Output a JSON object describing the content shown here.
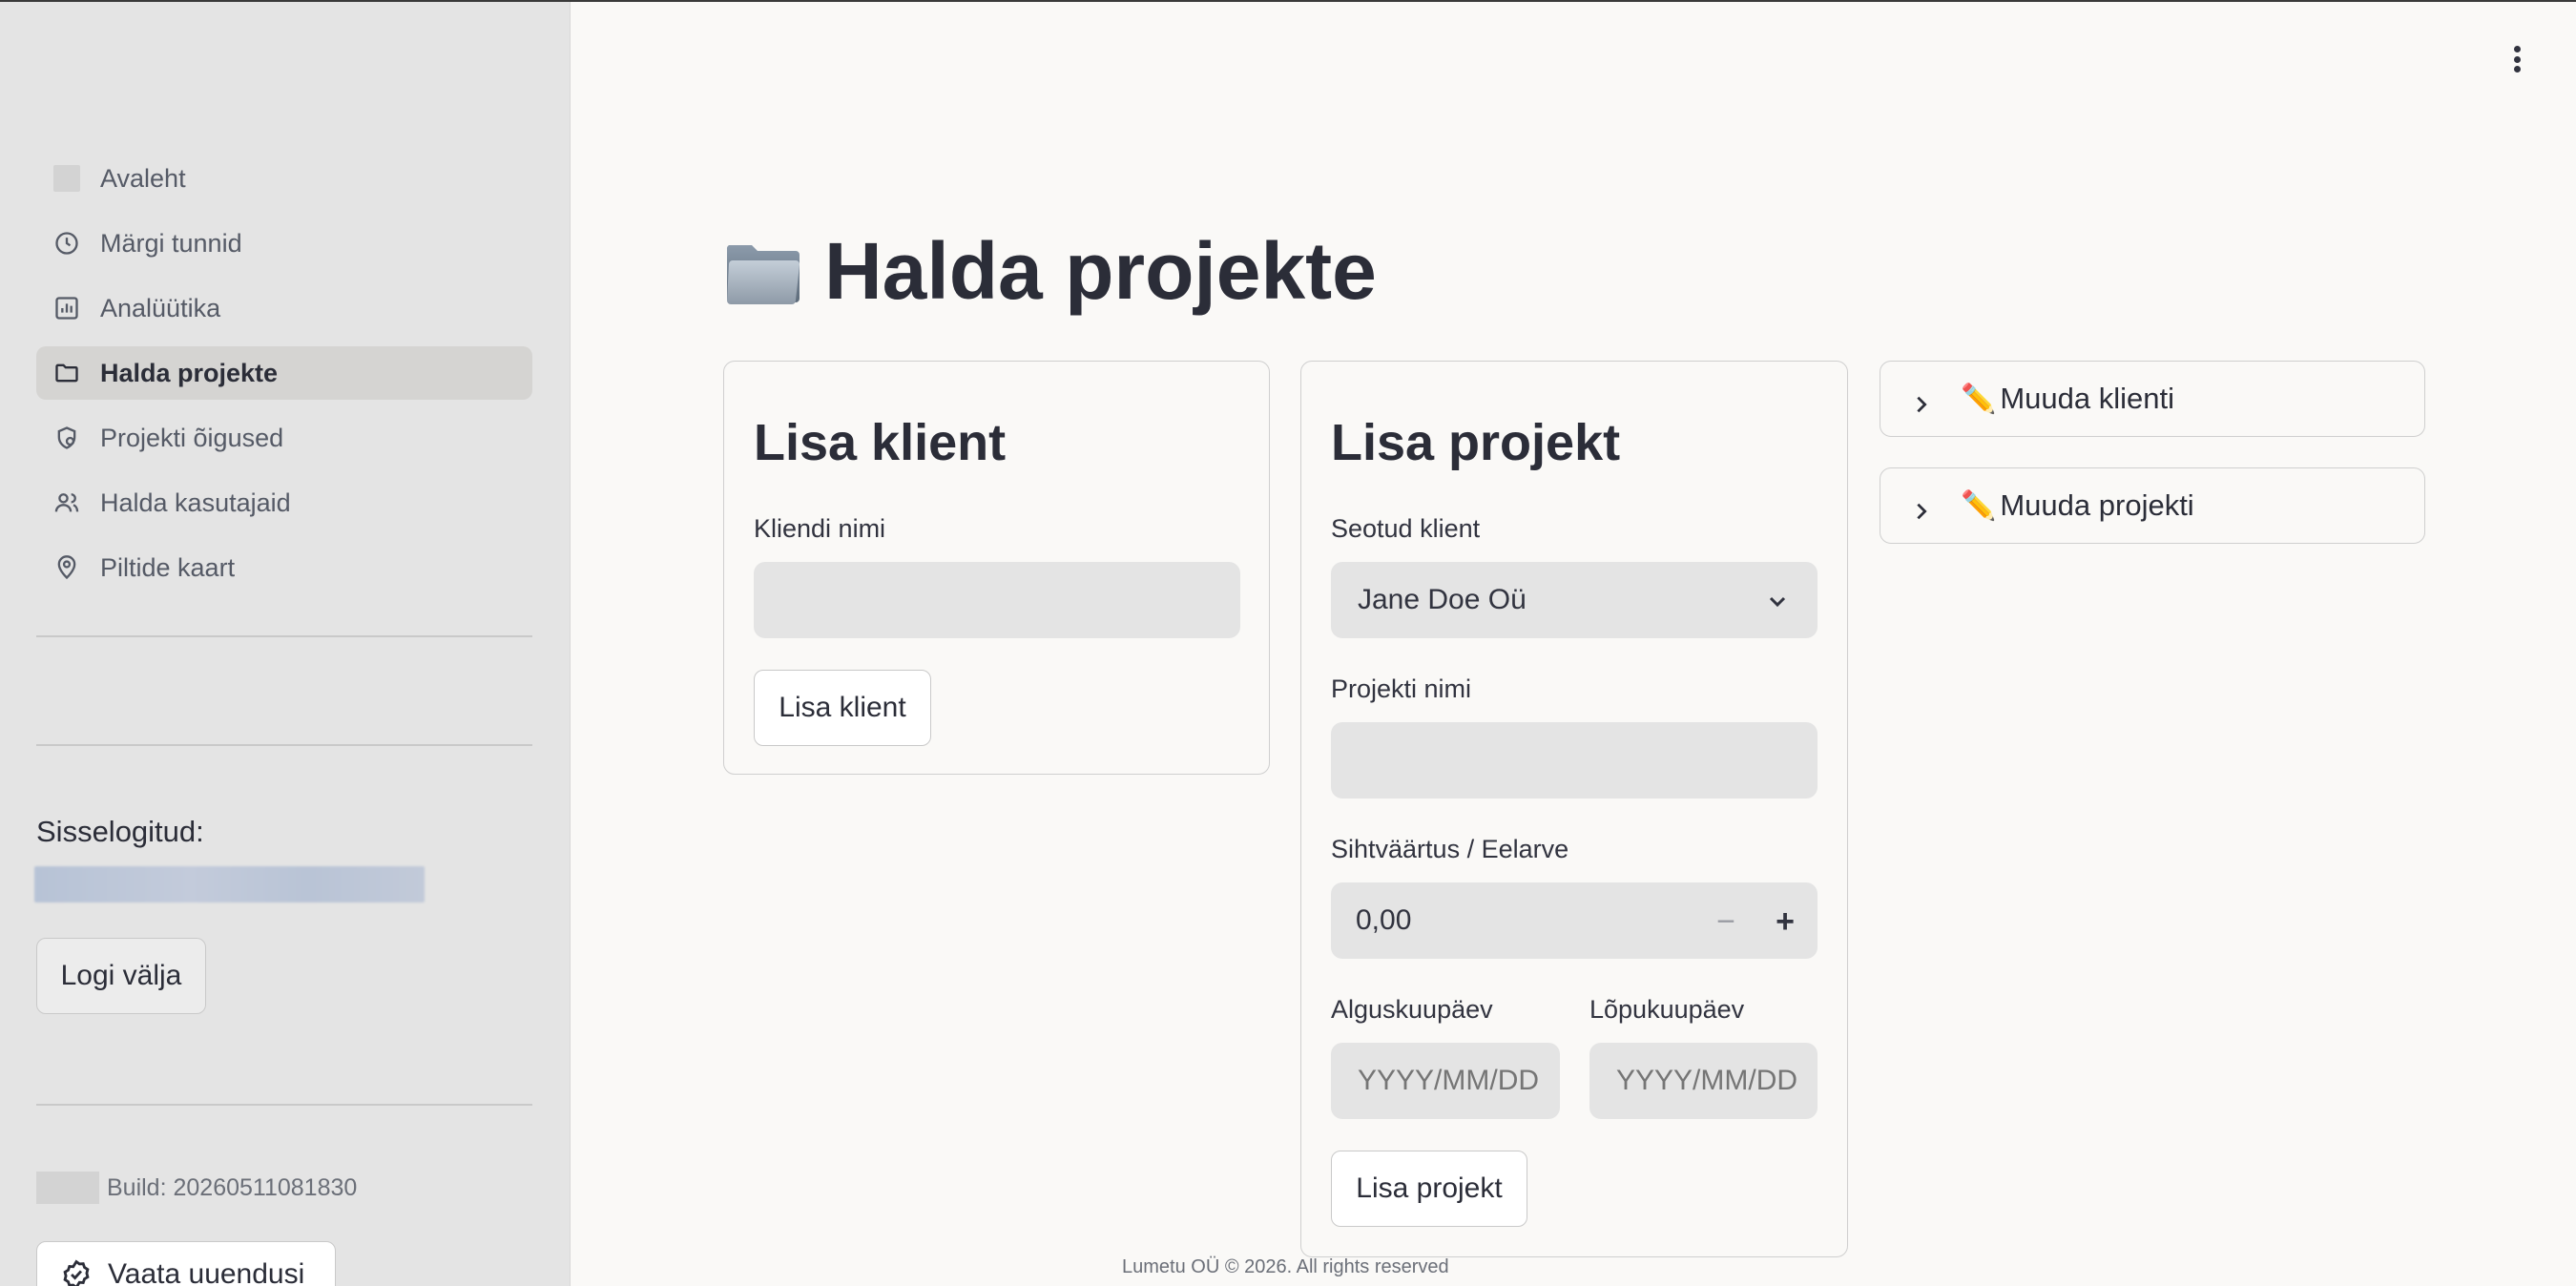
{
  "sidebar": {
    "items": [
      {
        "label": "Avaleht",
        "icon": "image-placeholder-icon"
      },
      {
        "label": "Märgi tunnid",
        "icon": "clock-icon"
      },
      {
        "label": "Analüütika",
        "icon": "bar-chart-icon"
      },
      {
        "label": "Halda projekte",
        "icon": "folder-icon",
        "active": true
      },
      {
        "label": "Projekti õigused",
        "icon": "shield-lock-icon"
      },
      {
        "label": "Halda kasutajaid",
        "icon": "users-icon"
      },
      {
        "label": "Piltide kaart",
        "icon": "map-pin-icon"
      }
    ],
    "logged_in_label": "Sisselogitud:",
    "logout_label": "Logi välja",
    "build_label": "Build: 20260511081830",
    "updates_label": "Vaata uuendusi"
  },
  "page": {
    "title": "Halda projekte",
    "title_emoji": "📁"
  },
  "add_client": {
    "title": "Lisa klient",
    "name_label": "Kliendi nimi",
    "name_value": "",
    "submit_label": "Lisa klient"
  },
  "add_project": {
    "title": "Lisa projekt",
    "client_label": "Seotud klient",
    "client_value": "Jane Doe Oü",
    "project_name_label": "Projekti nimi",
    "project_name_value": "",
    "budget_label": "Sihtväärtus / Eelarve",
    "budget_value": "0,00",
    "minus_label": "−",
    "plus_label": "+",
    "start_label": "Alguskuupäev",
    "start_placeholder": "YYYY/MM/DD",
    "end_label": "Lõpukuupäev",
    "end_placeholder": "YYYY/MM/DD",
    "submit_label": "Lisa projekt"
  },
  "expanders": [
    {
      "label": "Muuda klienti",
      "emoji": "✏️"
    },
    {
      "label": "Muuda projekti",
      "emoji": "✏️"
    }
  ],
  "footer": "Lumetu OÜ © 2026. All rights reserved"
}
